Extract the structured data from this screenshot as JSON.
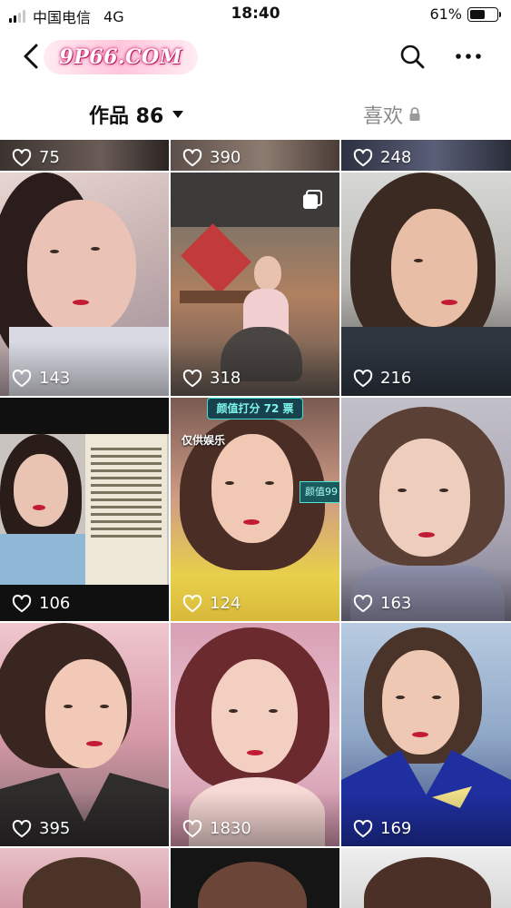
{
  "status_bar": {
    "carrier": "中国电信",
    "network": "4G",
    "time": "18:40",
    "battery": "61%",
    "battery_level": 0.61
  },
  "header": {
    "logo_text": "9P66.COM"
  },
  "icons": {
    "back": "chevron-left-icon",
    "search": "search-icon",
    "more": "more-dots-icon",
    "heart": "heart-outline-icon",
    "lock": "lock-icon",
    "multi": "multi-image-icon"
  },
  "tabs": {
    "works_label": "作品 86",
    "likes_label": "喜欢"
  },
  "grid": {
    "tiles": [
      {
        "likes": "75"
      },
      {
        "likes": "390"
      },
      {
        "likes": "248"
      },
      {
        "likes": "143"
      },
      {
        "likes": "318"
      },
      {
        "likes": "216"
      },
      {
        "likes": "106"
      },
      {
        "likes": "124"
      },
      {
        "likes": "163"
      },
      {
        "likes": "395"
      },
      {
        "likes": "1830"
      },
      {
        "likes": "169"
      }
    ]
  },
  "overlays": {
    "tile5_banner_score": "颜值打分  72 票",
    "tile5_tag": "仅供娱乐",
    "tile5_side": "颜值99"
  },
  "colors": {
    "accent": "#111111",
    "muted": "#8a8a8a",
    "lip": "#c21b35"
  }
}
